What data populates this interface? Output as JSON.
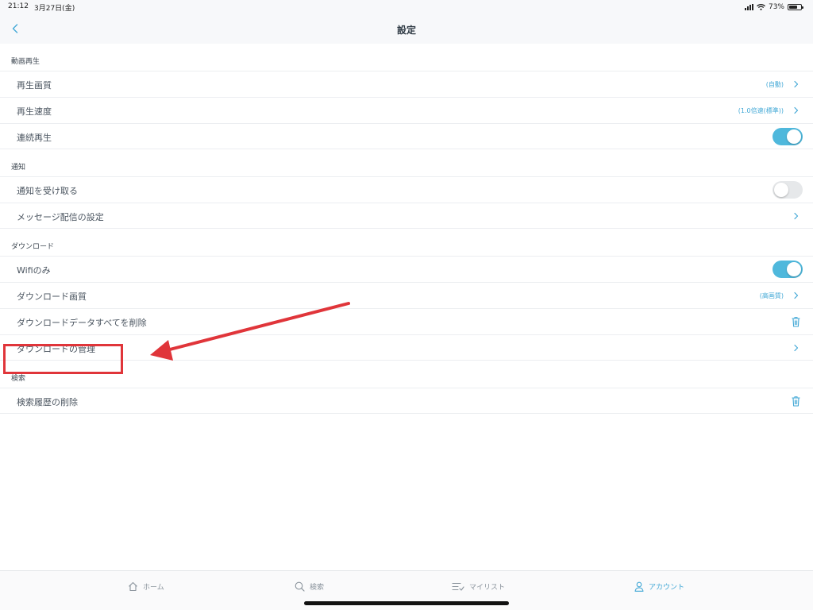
{
  "status_bar": {
    "time": "21:12",
    "date": "3月27日(金)",
    "battery_text": "73%",
    "battery_level": 0.73
  },
  "nav": {
    "title": "設定",
    "back_icon": "chevron-left-icon"
  },
  "sections": {
    "playback": {
      "header": "動画再生",
      "quality_label": "再生画質",
      "quality_value": "(自動)",
      "speed_label": "再生速度",
      "speed_value": "(1.0倍速(標準))",
      "autoplay_label": "連続再生",
      "autoplay_on": true
    },
    "notifications": {
      "header": "通知",
      "receive_label": "通知を受け取る",
      "receive_on": false,
      "message_label": "メッセージ配信の設定"
    },
    "download": {
      "header": "ダウンロード",
      "wifi_label": "Wifiのみ",
      "wifi_on": true,
      "quality_label": "ダウンロード画質",
      "quality_value": "(高画質)",
      "delete_all_label": "ダウンロードデータすべてを削除",
      "manage_label": "ダウンロードの管理"
    },
    "search": {
      "header": "検索",
      "delete_history_label": "検索履歴の削除"
    }
  },
  "tabbar": {
    "home": "ホーム",
    "search": "検索",
    "mylist": "マイリスト",
    "account": "アカウント",
    "active": "account"
  },
  "colors": {
    "accent": "#42a8d6",
    "toggle_on": "#4fb8dc",
    "annotation": "#e0353a"
  }
}
